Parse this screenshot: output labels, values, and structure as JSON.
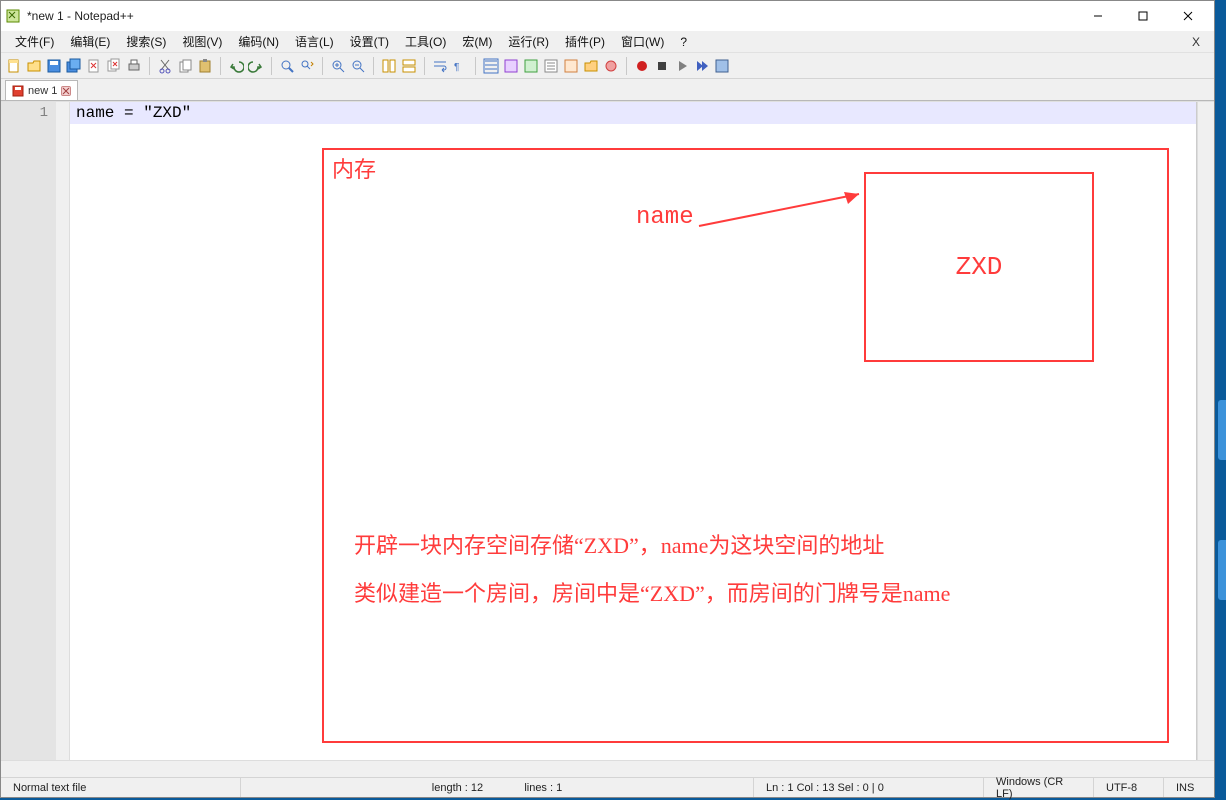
{
  "window": {
    "title": "*new 1 - Notepad++"
  },
  "menus": {
    "items": [
      "文件(F)",
      "编辑(E)",
      "搜索(S)",
      "视图(V)",
      "编码(N)",
      "语言(L)",
      "设置(T)",
      "工具(O)",
      "宏(M)",
      "运行(R)",
      "插件(P)",
      "窗口(W)",
      "?"
    ],
    "farright": "X"
  },
  "tab": {
    "name": "new 1"
  },
  "gutter": {
    "line1": "1"
  },
  "code": {
    "line1": "name = \"ZXD\""
  },
  "diagram": {
    "memory_label": "内存",
    "name_label": "name",
    "box_value": "ZXD",
    "explain_line1": "开辟一块内存空间存储“ZXD”，name为这块空间的地址",
    "explain_line2": "类似建造一个房间，房间中是“ZXD”，而房间的门牌号是name"
  },
  "status": {
    "filetype": "Normal text file",
    "length": "length : 12",
    "lines": "lines : 1",
    "pos": "Ln : 1    Col : 13    Sel : 0 | 0",
    "eol": "Windows (CR LF)",
    "enc": "UTF-8",
    "mode": "INS"
  }
}
